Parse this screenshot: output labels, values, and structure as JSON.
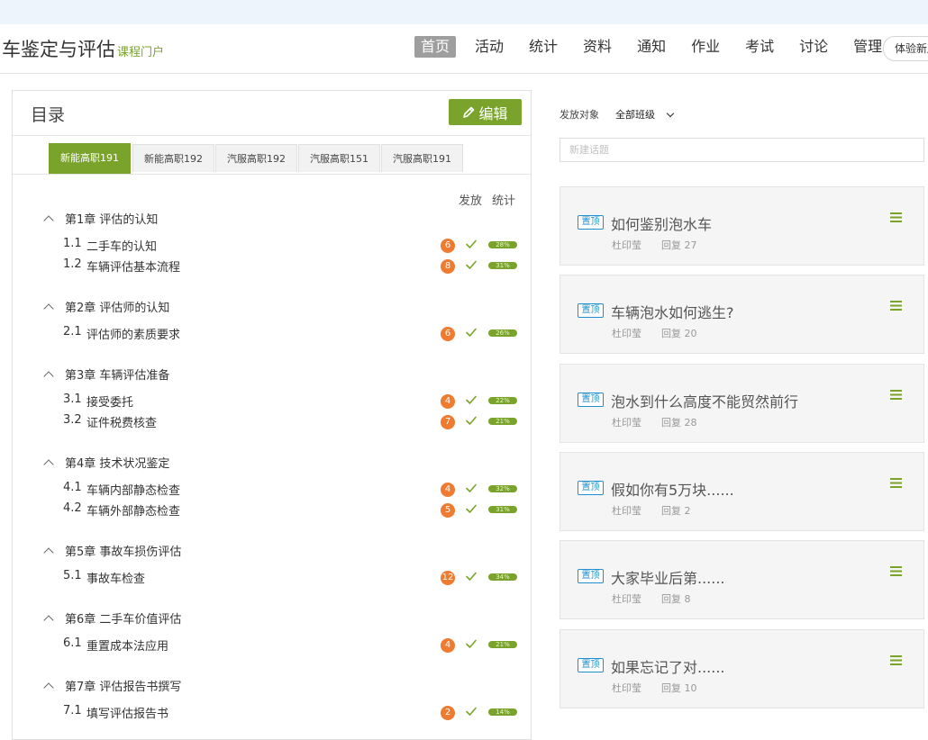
{
  "header": {
    "course_title": "车鉴定与评估",
    "portal_label": "课程门户",
    "nav": [
      {
        "label": "首页",
        "active": true
      },
      {
        "label": "活动"
      },
      {
        "label": "统计"
      },
      {
        "label": "资料"
      },
      {
        "label": "通知"
      },
      {
        "label": "作业"
      },
      {
        "label": "考试"
      },
      {
        "label": "讨论"
      },
      {
        "label": "管理"
      }
    ],
    "trial_label": "体验新版"
  },
  "catalog": {
    "title": "目录",
    "edit_label": "编辑",
    "tabs": [
      "新能高职191",
      "新能高职192",
      "汽服高职192",
      "汽服高职151",
      "汽服高职191"
    ],
    "active_tab": 0,
    "col_publish": "发放",
    "col_stats": "统计",
    "chapters": [
      {
        "title": "第1章 评估的认知",
        "sections": [
          {
            "num": "1.1",
            "name": "二手车的认知",
            "count": "6",
            "progress": "28%"
          },
          {
            "num": "1.2",
            "name": "车辆评估基本流程",
            "count": "8",
            "progress": "31%"
          }
        ]
      },
      {
        "title": "第2章 评估师的认知",
        "sections": [
          {
            "num": "2.1",
            "name": "评估师的素质要求",
            "count": "6",
            "progress": "26%"
          }
        ]
      },
      {
        "title": "第3章 车辆评估准备",
        "sections": [
          {
            "num": "3.1",
            "name": "接受委托",
            "count": "4",
            "progress": "22%"
          },
          {
            "num": "3.2",
            "name": "证件税费核查",
            "count": "7",
            "progress": "21%"
          }
        ]
      },
      {
        "title": "第4章 技术状况鉴定",
        "sections": [
          {
            "num": "4.1",
            "name": "车辆内部静态检查",
            "count": "4",
            "progress": "32%"
          },
          {
            "num": "4.2",
            "name": "车辆外部静态检查",
            "count": "5",
            "progress": "31%"
          }
        ]
      },
      {
        "title": "第5章 事故车损伤评估",
        "sections": [
          {
            "num": "5.1",
            "name": "事故车检查",
            "count": "12",
            "progress": "34%"
          }
        ]
      },
      {
        "title": "第6章 二手车价值评估",
        "sections": [
          {
            "num": "6.1",
            "name": "重置成本法应用",
            "count": "4",
            "progress": "21%"
          }
        ]
      },
      {
        "title": "第7章 评估报告书撰写",
        "sections": [
          {
            "num": "7.1",
            "name": "填写评估报告书",
            "count": "2",
            "progress": "14%"
          }
        ]
      }
    ]
  },
  "discussion": {
    "target_label": "发放对象",
    "target_value": "全部班级",
    "new_topic_placeholder": "新建话题",
    "pin_label": "置顶",
    "topics": [
      {
        "title": "如何鉴别泡水车",
        "author": "杜印莹",
        "replies": "回复 27"
      },
      {
        "title": "车辆泡水如何逃生?",
        "author": "杜印莹",
        "replies": "回复 20"
      },
      {
        "title": "泡水到什么高度不能贸然前行",
        "author": "杜印莹",
        "replies": "回复 28"
      },
      {
        "title": "假如你有5万块......",
        "author": "杜印莹",
        "replies": "回复 2"
      },
      {
        "title": "大家毕业后第......",
        "author": "杜印莹",
        "replies": "回复 8"
      },
      {
        "title": "如果忘记了对......",
        "author": "杜印莹",
        "replies": "回复 10"
      }
    ]
  },
  "colors": {
    "accent": "#7aa32b",
    "badge": "#ef7b31",
    "pin": "#1e8fd0"
  },
  "icons": {
    "edit": "pencil-icon",
    "collapse": "chevron-up-icon",
    "published": "check-icon",
    "topic_menu": "hamburger-menu-icon",
    "select": "chevron-down-icon"
  }
}
